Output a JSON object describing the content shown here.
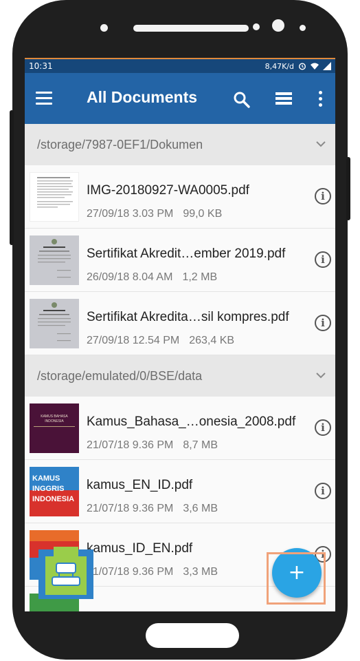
{
  "status_bar": {
    "time": "10:31",
    "network_speed": "8,47K/d",
    "icons": [
      "alarm-icon",
      "wifi-icon",
      "signal-icon"
    ]
  },
  "app_bar": {
    "title": "All Documents",
    "icons": [
      "menu-icon",
      "search-icon",
      "list-view-icon",
      "more-icon"
    ]
  },
  "groups": [
    {
      "path": "/storage/7987-0EF1/Dokumen",
      "files": [
        {
          "name": "IMG-20180927-WA0005.pdf",
          "date": "27/09/18 3.03 PM",
          "size": "99,0 KB",
          "thumb": "document-page"
        },
        {
          "name": "Sertifikat Akredit…ember 2019.pdf",
          "date": "26/09/18 8.04 AM",
          "size": "1,2 MB",
          "thumb": "certificate"
        },
        {
          "name": "Sertifikat Akredita…sil kompres.pdf",
          "date": "27/09/18 12.54 PM",
          "size": "263,4 KB",
          "thumb": "certificate"
        }
      ]
    },
    {
      "path": "/storage/emulated/0/BSE/data",
      "files": [
        {
          "name": "Kamus_Bahasa_…onesia_2008.pdf",
          "date": "21/07/18 9.36 PM",
          "size": "8,7 MB",
          "thumb": "kamus-bahasa-cover",
          "cover_title": "KAMUS BAHASA INDONESIA"
        },
        {
          "name": "kamus_EN_ID.pdf",
          "date": "21/07/18 9.36 PM",
          "size": "3,6 MB",
          "thumb": "kamus-inggris-cover",
          "cover_lines": [
            "KAMUS",
            "INGGRIS",
            "INDONESIA"
          ]
        },
        {
          "name": "kamus_ID_EN.pdf",
          "date": "21/07/18 9.36 PM",
          "size": "3,3 MB",
          "thumb": "kamus-indonesia-cover"
        }
      ]
    }
  ],
  "fab": {
    "label": "+",
    "color": "#2aa4e4"
  },
  "colors": {
    "appbar": "#2364a6",
    "statusbar": "#16477a",
    "group_header": "#e7e7e7",
    "highlight": "#f0a27a"
  }
}
